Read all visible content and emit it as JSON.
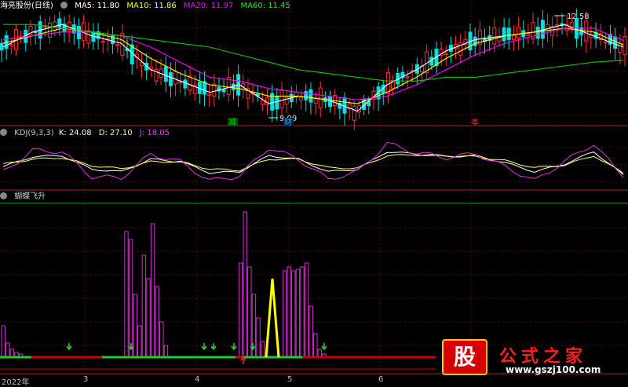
{
  "main_panel": {
    "stock_name": "海亮股份(日线)",
    "ma": [
      {
        "label": "MA5: 11.80",
        "color": "#ffffff"
      },
      {
        "label": "MA10: 11.86",
        "color": "#ffff00"
      },
      {
        "label": "MA20: 11.97",
        "color": "#ff00ff"
      },
      {
        "label": "MA60: 11.45",
        "color": "#00ff00"
      }
    ],
    "high_label": "12.58",
    "low_label": "9.99",
    "markers": [
      {
        "text": "减",
        "color": "#00cc00"
      },
      {
        "text": "财",
        "color": "#00a0ff"
      },
      {
        "text": "本",
        "color": "#ff3030"
      }
    ]
  },
  "kdj_panel": {
    "title": "KDJ(9,3,3)",
    "k": "K: 24.08",
    "d": "D: 27.10",
    "j": "J: 18.05"
  },
  "indicator_panel": {
    "title": "蝴蝶飞升"
  },
  "x_axis": {
    "labels": [
      "2022年",
      "3",
      "4",
      "5",
      "6"
    ]
  },
  "watermark": {
    "badge": "股",
    "name": "公式之家",
    "url": "www.gszj100.com"
  },
  "chart_data": [
    {
      "type": "line",
      "title": "海亮股份(日线)",
      "series": [
        {
          "name": "MA5",
          "values": [
            11.8,
            12.2,
            12.4,
            12.1,
            11.9,
            11.2,
            10.9,
            10.6,
            10.8,
            10.3,
            10.5,
            10.4,
            10.1,
            10.8,
            11.2,
            11.7,
            12.0,
            12.1,
            12.2,
            12.4,
            12.1,
            11.8
          ]
        },
        {
          "name": "MA10",
          "values": [
            11.9,
            12.1,
            12.3,
            12.2,
            12.0,
            11.5,
            11.1,
            10.8,
            10.7,
            10.5,
            10.5,
            10.4,
            10.3,
            10.6,
            11.0,
            11.5,
            11.9,
            12.1,
            12.2,
            12.3,
            12.2,
            11.86
          ]
        },
        {
          "name": "MA20",
          "values": [
            12.0,
            12.1,
            12.2,
            12.2,
            12.1,
            11.8,
            11.4,
            11.0,
            10.9,
            10.7,
            10.6,
            10.5,
            10.4,
            10.5,
            10.8,
            11.2,
            11.6,
            11.9,
            12.1,
            12.3,
            12.3,
            11.97
          ]
        },
        {
          "name": "MA60",
          "values": [
            12.4,
            12.4,
            12.3,
            12.2,
            12.1,
            12.0,
            11.9,
            11.8,
            11.6,
            11.4,
            11.2,
            11.1,
            11.0,
            10.9,
            10.9,
            11.0,
            11.0,
            11.1,
            11.2,
            11.3,
            11.4,
            11.45
          ]
        }
      ],
      "annotations": [
        "12.58",
        "9.99"
      ]
    },
    {
      "type": "line",
      "title": "KDJ(9,3,3)",
      "series": [
        {
          "name": "K",
          "values": [
            40,
            60,
            62,
            35,
            30,
            55,
            50,
            28,
            30,
            62,
            55,
            30,
            35,
            70,
            65,
            60,
            62,
            48,
            30,
            45,
            70,
            24.08
          ]
        },
        {
          "name": "D",
          "values": [
            45,
            55,
            58,
            42,
            36,
            50,
            50,
            35,
            33,
            55,
            55,
            38,
            37,
            62,
            64,
            62,
            60,
            52,
            38,
            43,
            62,
            27.1
          ]
        },
        {
          "name": "J",
          "values": [
            30,
            72,
            70,
            20,
            18,
            65,
            50,
            12,
            22,
            78,
            55,
            15,
            30,
            86,
            68,
            58,
            66,
            40,
            12,
            50,
            86,
            18.05
          ]
        }
      ]
    },
    {
      "type": "bar",
      "title": "蝴蝶飞升",
      "bars": [
        {
          "i": 0,
          "v": 40
        },
        {
          "i": 1,
          "v": 18
        },
        {
          "i": 2,
          "v": 10
        },
        {
          "i": 3,
          "v": 6
        },
        {
          "i": 4,
          "v": 4
        },
        {
          "i": 28,
          "v": 160
        },
        {
          "i": 29,
          "v": 150
        },
        {
          "i": 30,
          "v": 80
        },
        {
          "i": 31,
          "v": 40
        },
        {
          "i": 32,
          "v": 130
        },
        {
          "i": 33,
          "v": 100
        },
        {
          "i": 34,
          "v": 170
        },
        {
          "i": 35,
          "v": 90
        },
        {
          "i": 36,
          "v": 45
        },
        {
          "i": 37,
          "v": 15
        },
        {
          "i": 54,
          "v": 120
        },
        {
          "i": 55,
          "v": 185
        },
        {
          "i": 56,
          "v": 115
        },
        {
          "i": 57,
          "v": 80
        },
        {
          "i": 58,
          "v": 50
        },
        {
          "i": 59,
          "v": 20
        },
        {
          "i": 64,
          "v": 110
        },
        {
          "i": 65,
          "v": 115
        },
        {
          "i": 66,
          "v": 110
        },
        {
          "i": 67,
          "v": 112
        },
        {
          "i": 68,
          "v": 115
        },
        {
          "i": 69,
          "v": 120
        },
        {
          "i": 70,
          "v": 65
        },
        {
          "i": 71,
          "v": 30
        },
        {
          "i": 72,
          "v": 10
        },
        {
          "i": 73,
          "v": 4
        }
      ],
      "signal_peak": 100,
      "colors": {
        "bars": "#cc33cc",
        "signal": "#ffff00",
        "baseline_green": "#22cc22",
        "baseline_red": "#cc0000"
      }
    }
  ]
}
